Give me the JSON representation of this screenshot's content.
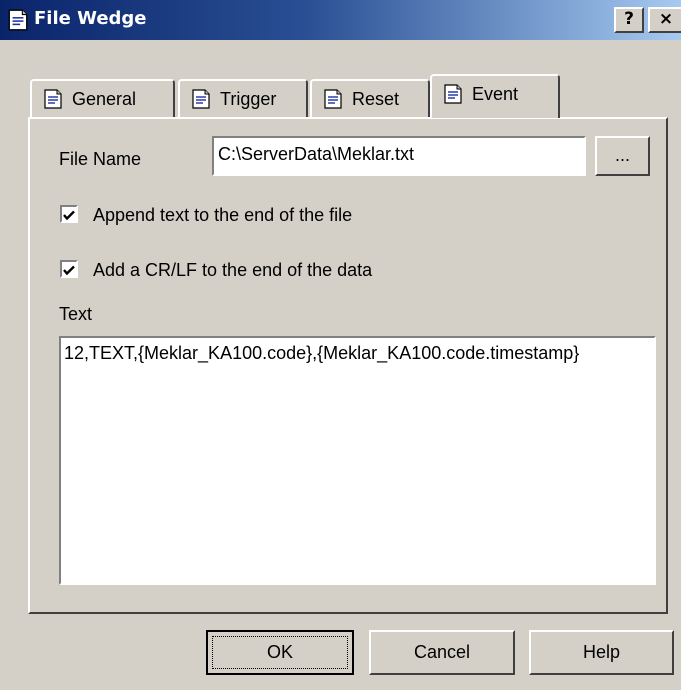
{
  "window": {
    "title": "File Wedge",
    "help_button": "?",
    "close_button": "×"
  },
  "tabs": [
    {
      "label": "General",
      "icon": "document-icon"
    },
    {
      "label": "Trigger",
      "icon": "document-icon"
    },
    {
      "label": "Reset",
      "icon": "document-icon"
    },
    {
      "label": "Event",
      "icon": "document-icon",
      "active": true
    }
  ],
  "event": {
    "file_name_label": "File Name",
    "file_name_value": "C:\\ServerData\\Meklar.txt",
    "browse_label": "...",
    "append_label": "Append text to the end of the file",
    "append_checked": true,
    "crlf_label": "Add a CR/LF to the end of the data",
    "crlf_checked": true,
    "text_label": "Text",
    "text_value": "12,TEXT,{Meklar_KA100.code},{Meklar_KA100.code.timestamp}"
  },
  "buttons": {
    "ok": "OK",
    "cancel": "Cancel",
    "help": "Help"
  },
  "colors": {
    "face": "#d4d0c8",
    "title_start": "#0a246a",
    "title_end": "#a6caf0"
  }
}
